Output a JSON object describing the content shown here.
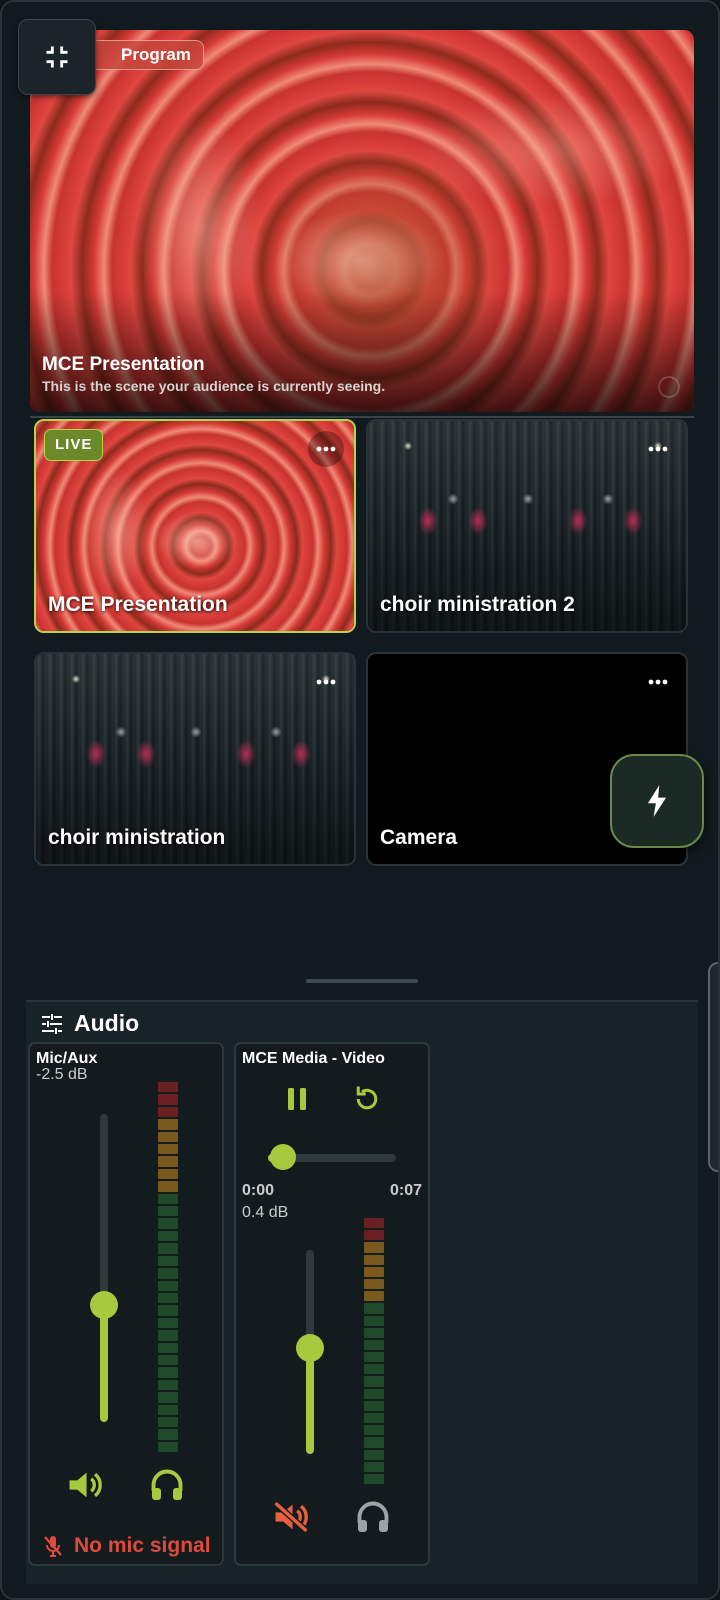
{
  "program": {
    "badge": "Program",
    "title": "MCE Presentation",
    "subtitle": "This is the scene your audience is currently seeing."
  },
  "scenes": [
    {
      "name": "MCE Presentation",
      "live": true,
      "badge": "LIVE",
      "preview": "marble"
    },
    {
      "name": "choir ministration 2",
      "live": false,
      "preview": "choir"
    },
    {
      "name": "choir ministration",
      "live": false,
      "preview": "choir"
    },
    {
      "name": "Camera",
      "live": false,
      "preview": "black"
    }
  ],
  "audio": {
    "title": "Audio",
    "channels": [
      {
        "name": "Mic/Aux",
        "db": "-2.5 dB",
        "fader_level": 0.38,
        "warning": "No mic signal",
        "muted": false,
        "monitor": true
      },
      {
        "name": "MCE Media - Video",
        "db": "0.4 dB",
        "fader_level": 0.52,
        "time_current": "0:00",
        "time_total": "0:07",
        "progress": 0.04,
        "muted": true,
        "monitor": false
      }
    ]
  },
  "colors": {
    "accent": "#a6c93e",
    "live_border": "#b6d34a",
    "warning": "#e04a3a",
    "background": "#111a1e"
  },
  "icons": {
    "collapse": "fullscreen-exit-icon",
    "flash": "lightning-icon",
    "more": "more-horizontal-icon",
    "mixer": "sliders-icon",
    "volume": "volume-icon",
    "headphones": "headphones-icon",
    "pause": "pause-icon",
    "restart": "restart-icon",
    "mic_off": "mic-off-icon",
    "muted": "volume-off-icon"
  }
}
